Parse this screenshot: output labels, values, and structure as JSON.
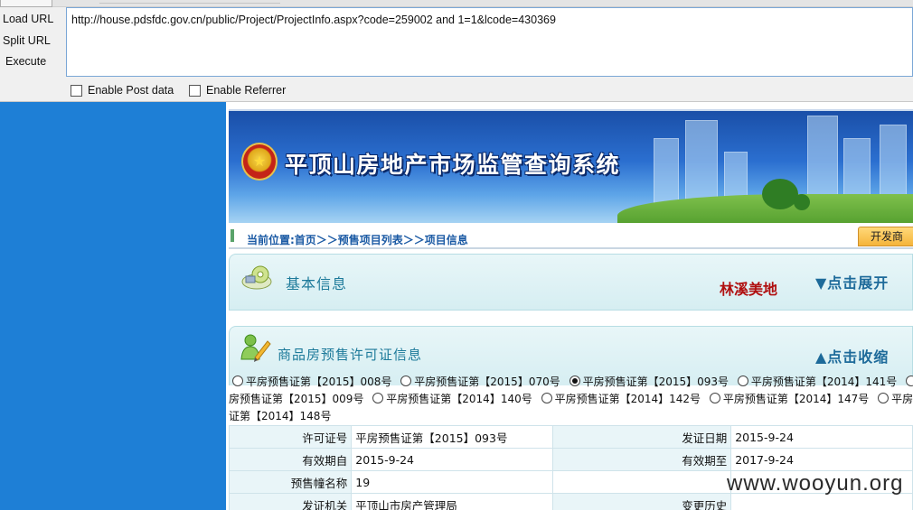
{
  "toolbar": {
    "buttons": {
      "load": "Load URL",
      "split": "Split URL",
      "execute": "Execute"
    },
    "url": "http://house.pdsfdc.gov.cn/public/Project/ProjectInfo.aspx?code=259002 and 1=1&lcode=430369",
    "options": {
      "post": "Enable Post data",
      "referrer": "Enable Referrer"
    }
  },
  "page": {
    "banner_title": "平顶山房地产市场监管查询系统",
    "breadcrumb": "当前位置:首页＞＞预售项目列表＞＞项目信息",
    "dev_tab": "开发商",
    "basic_panel": {
      "title": "基本信息",
      "company": "林溪美地",
      "toggle": "▼点击展开"
    },
    "permit_panel": {
      "title": "商品房预售许可证信息",
      "toggle": "▲点击收缩"
    },
    "cert_rows": [
      [
        "平房预售证第【2015】008号",
        "平房预售证第【2015】070号",
        "平房预售证第【2015】093号",
        "平房预售证第【2014】141号"
      ],
      [
        "房预售证第【2015】009号",
        "平房预售证第【2014】140号",
        "平房预售证第【2014】142号",
        "平房预售证第【2014】147号",
        "平房预"
      ],
      [
        "证第【2014】148号"
      ]
    ],
    "selected_cert": "平房预售证第【2015】093号",
    "details": {
      "permit_no_label": "许可证号",
      "permit_no": "平房预售证第【2015】093号",
      "issue_date_label": "发证日期",
      "issue_date": "2015-9-24",
      "valid_from_label": "有效期自",
      "valid_from": "2015-9-24",
      "valid_to_label": "有效期至",
      "valid_to": "2017-9-24",
      "building_label": "预售幢名称",
      "building": "19",
      "authority_label": "发证机关",
      "authority": "平顶山市房产管理局",
      "history_label": "变更历史"
    }
  },
  "watermark": "www.wooyun.org"
}
